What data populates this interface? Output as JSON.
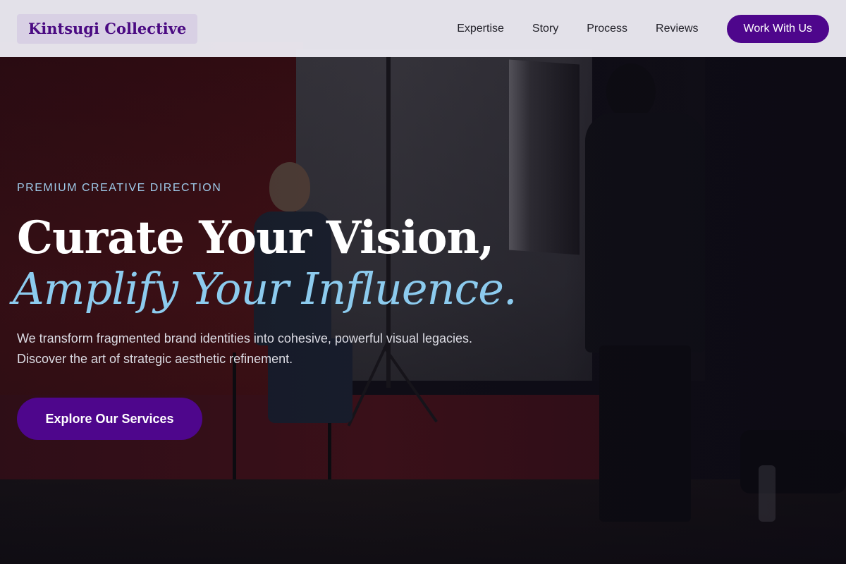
{
  "header": {
    "brand": "Kintsugi Collective",
    "nav": [
      {
        "label": "Expertise"
      },
      {
        "label": "Story"
      },
      {
        "label": "Process"
      },
      {
        "label": "Reviews"
      }
    ],
    "cta_label": "Work With Us"
  },
  "hero": {
    "eyebrow": "PREMIUM CREATIVE DIRECTION",
    "headline_line1": "Curate Your Vision,",
    "headline_line2": "Amplify Your Influence.",
    "subtitle_line1": "We transform fragmented brand identities into cohesive, powerful visual legacies.",
    "subtitle_line2": "Discover the art of strategic aesthetic refinement.",
    "cta_label": "Explore Our Services",
    "background_image": "photo-studio-shoot"
  },
  "colors": {
    "brand_purple": "#4e068c",
    "accent_blue": "#8ccbee",
    "header_bg": "#eceaf2"
  }
}
